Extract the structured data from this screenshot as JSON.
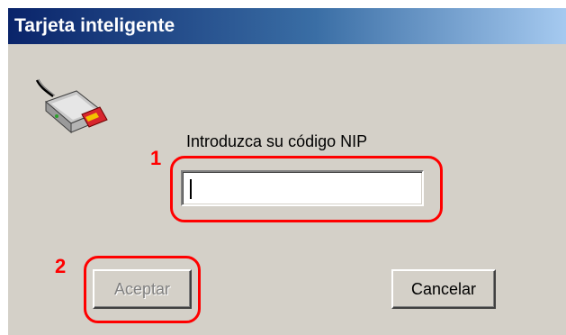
{
  "window": {
    "title": "Tarjeta inteligente"
  },
  "icon": {
    "name": "smart-card-reader-icon"
  },
  "prompt": {
    "label": "Introduzca su código NIP"
  },
  "pin_input": {
    "value": "",
    "placeholder": ""
  },
  "annotations": {
    "step1": "1",
    "step2": "2",
    "color": "#ff0000"
  },
  "buttons": {
    "accept_label": "Aceptar",
    "accept_enabled": false,
    "cancel_label": "Cancelar"
  },
  "colors": {
    "dialog_background": "#d4d0c8",
    "titlebar_start": "#0a246a",
    "titlebar_end": "#a6caf0"
  }
}
